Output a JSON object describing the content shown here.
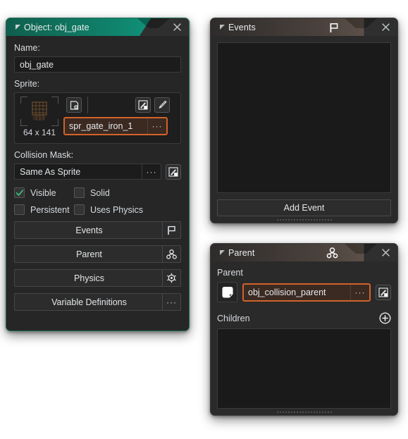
{
  "colors": {
    "accent_teal": "#0fa184",
    "highlight_orange": "#d2622a",
    "checkbox_green": "#3cb878",
    "window_bg": "#262626",
    "panel_bg": "#2a2a2a",
    "input_bg": "#1c1c1c",
    "page_bg": "#ffffff"
  },
  "object_window": {
    "title": "Object: obj_gate",
    "collapse_icon": "triangle-collapse-icon",
    "close_icon": "close-icon",
    "name": {
      "label": "Name:",
      "value": "obj_gate"
    },
    "sprite": {
      "label": "Sprite:",
      "value": "spr_gate_iron_1",
      "dimensions": "64 x 141",
      "dots_label": "···",
      "new_sprite_icon": "new-sprite-icon",
      "edit_sprite_icon": "edit-sprite-icon",
      "paint_sprite_icon": "paintbrush-icon"
    },
    "collision_mask": {
      "label": "Collision Mask:",
      "value": "Same As Sprite",
      "dots_label": "···",
      "edit_icon": "edit-mask-icon"
    },
    "checkboxes": [
      {
        "label": "Visible",
        "checked": true
      },
      {
        "label": "Solid",
        "checked": false
      },
      {
        "label": "Persistent",
        "checked": false
      },
      {
        "label": "Uses Physics",
        "checked": false
      }
    ],
    "buttons": [
      {
        "label": "Events",
        "icon": "flag-icon"
      },
      {
        "label": "Parent",
        "icon": "parent-hierarchy-icon"
      },
      {
        "label": "Physics",
        "icon": "physics-gear-icon"
      },
      {
        "label": "Variable Definitions",
        "icon": "ellipsis-icon"
      }
    ]
  },
  "events_window": {
    "title": "Events",
    "title_icon": "flag-icon",
    "collapse_icon": "triangle-collapse-icon",
    "close_icon": "close-icon",
    "list_items": [],
    "add_event_label": "Add Event"
  },
  "parent_window": {
    "title": "Parent",
    "title_icon": "parent-hierarchy-icon",
    "collapse_icon": "triangle-collapse-icon",
    "close_icon": "close-icon",
    "parent_label": "Parent",
    "parent_value": "obj_collision_parent",
    "parent_dots_label": "···",
    "object_icon": "object-square-icon",
    "edit_icon": "edit-parent-icon",
    "children_label": "Children",
    "children_add_icon": "plus-circle-icon",
    "children_items": []
  }
}
